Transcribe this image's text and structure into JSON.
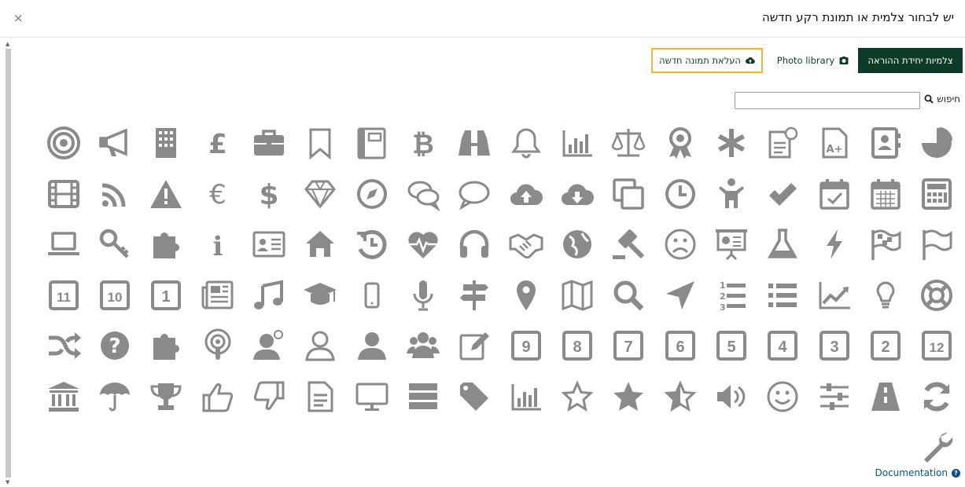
{
  "dialog": {
    "title": "יש לבחור צלמית או תמונת רקע חדשה",
    "close_symbol": "×"
  },
  "toolbar": {
    "unit_icons_label": "צלמיות יחידת ההוראה",
    "photo_library_label": "Photo library",
    "upload_label": "העלאת תמונה חדשה"
  },
  "search": {
    "label": "חיפוש",
    "value": "",
    "placeholder": ""
  },
  "footer": {
    "documentation_label": "Documentation",
    "help_symbol": "?"
  },
  "colors": {
    "primary": "#0c3b27",
    "highlight_border": "#f2b33b",
    "icon_gray": "#8a8a8a",
    "link": "#0c4f8a"
  },
  "icons": [
    "pie-chart",
    "address-book",
    "grade-a-plus",
    "document-clock",
    "asterisk",
    "award-ribbon",
    "scales",
    "bar-chart",
    "bell",
    "binoculars",
    "bitcoin",
    "notebook",
    "bookmark",
    "briefcase",
    "pound",
    "building",
    "megaphone",
    "target",
    "calculator",
    "calendar",
    "calendar-check",
    "checkmark",
    "child",
    "clock",
    "copy",
    "cloud-download",
    "cloud-upload",
    "speech-bubble",
    "chat-bubbles",
    "compass",
    "diamond",
    "dollar",
    "euro",
    "warning",
    "rss",
    "film",
    "flag-outline",
    "flag-checkered",
    "lightning",
    "flask",
    "presentation",
    "sad-face",
    "gavel",
    "globe",
    "handshake",
    "headphones",
    "heartbeat",
    "history",
    "home",
    "id-card",
    "info",
    "puzzle-pieces",
    "key",
    "laptop",
    "life-ring",
    "lightbulb",
    "line-chart",
    "list",
    "numbered-list",
    "location-arrow",
    "magnifier",
    "map",
    "map-pin",
    "signpost",
    "microphone",
    "mobile-phone",
    "graduation-cap",
    "music",
    "newspaper",
    "number-1",
    "number-10",
    "number-11",
    "number-12",
    "number-2",
    "number-3",
    "number-4",
    "number-5",
    "number-6",
    "number-7",
    "number-8",
    "number-9",
    "edit",
    "users",
    "user",
    "user-outline",
    "user-idea",
    "podcast",
    "puzzle",
    "question",
    "shuffle",
    "refresh",
    "road",
    "sliders",
    "smile",
    "volume",
    "star-half",
    "star",
    "star-outline",
    "bar-chart",
    "tag",
    "server",
    "monitor",
    "document",
    "thumbs-down",
    "thumbs-up",
    "trophy",
    "umbrella",
    "bank",
    "wrench"
  ]
}
